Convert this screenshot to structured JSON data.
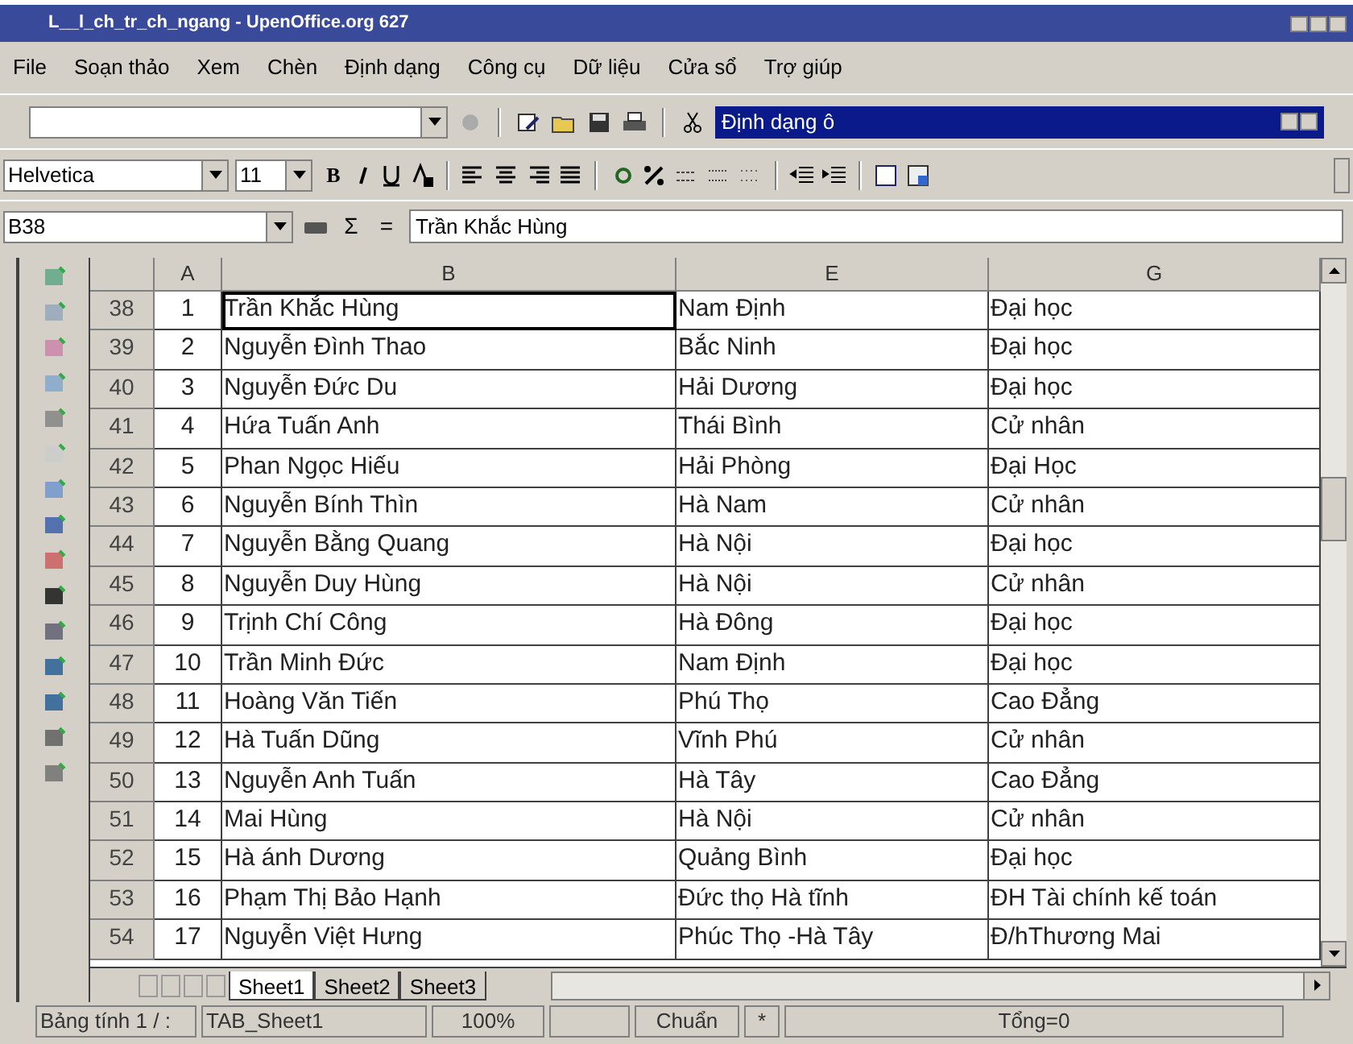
{
  "window": {
    "title": "L__l_ch_tr_ch_ngang - UpenOffice.org 627"
  },
  "menu": [
    "File",
    "Soạn thảo",
    "Xem",
    "Chèn",
    "Định dạng",
    "Công cụ",
    "Dữ liệu",
    "Cửa sổ",
    "Trợ giúp"
  ],
  "floating_toolbar": {
    "title": "Định dạng ô"
  },
  "format_bar": {
    "font": "Helvetica",
    "size": "11",
    "bold": "B"
  },
  "formula_bar": {
    "cell": "B38",
    "content": "Trần Khắc Hùng",
    "sum": "Σ",
    "equals": "="
  },
  "table": {
    "columns": [
      "A",
      "B",
      "E",
      "G"
    ],
    "rows": [
      {
        "row": "38",
        "cells": [
          "1",
          "Trần Khắc Hùng",
          "Nam Định",
          "Đại học"
        ],
        "selected": true
      },
      {
        "row": "39",
        "cells": [
          "2",
          "Nguyễn Đình Thao",
          "Bắc Ninh",
          "Đại học"
        ],
        "selected": false
      },
      {
        "row": "40",
        "cells": [
          "3",
          "Nguyễn Đức Du",
          "Hải Dương",
          "Đại học"
        ],
        "selected": false
      },
      {
        "row": "41",
        "cells": [
          "4",
          "Hứa Tuấn Anh",
          "Thái Bình",
          "Cử nhân"
        ],
        "selected": false
      },
      {
        "row": "42",
        "cells": [
          "5",
          "Phan Ngọc Hiếu",
          "Hải Phòng",
          "Đại Học"
        ],
        "selected": false
      },
      {
        "row": "43",
        "cells": [
          "6",
          "Nguyễn Bính Thìn",
          "Hà Nam",
          "Cử nhân"
        ],
        "selected": false
      },
      {
        "row": "44",
        "cells": [
          "7",
          "Nguyễn Bằng Quang",
          "Hà Nội",
          "Đại học"
        ],
        "selected": false
      },
      {
        "row": "45",
        "cells": [
          "8",
          "Nguyễn Duy Hùng",
          "Hà Nội",
          "Cử nhân"
        ],
        "selected": false
      },
      {
        "row": "46",
        "cells": [
          "9",
          "Trịnh Chí Công",
          "Hà Đông",
          "Đại học"
        ],
        "selected": false
      },
      {
        "row": "47",
        "cells": [
          "10",
          "Trần Minh Đức",
          "Nam Định",
          "Đại học"
        ],
        "selected": false
      },
      {
        "row": "48",
        "cells": [
          "11",
          "Hoàng Văn Tiến",
          "Phú Thọ",
          "Cao Đẳng"
        ],
        "selected": false
      },
      {
        "row": "49",
        "cells": [
          "12",
          "Hà Tuấn Dũng",
          "Vĩnh Phú",
          "Cử nhân"
        ],
        "selected": false
      },
      {
        "row": "50",
        "cells": [
          "13",
          "Nguyễn Anh Tuấn",
          "Hà Tây",
          "Cao Đẳng"
        ],
        "selected": false
      },
      {
        "row": "51",
        "cells": [
          "14",
          "Mai Hùng",
          "Hà Nội",
          "Cử nhân"
        ],
        "selected": false
      },
      {
        "row": "52",
        "cells": [
          "15",
          "Hà ánh Dương",
          "Quảng Bình",
          "Đại học"
        ],
        "selected": false
      },
      {
        "row": "53",
        "cells": [
          "16",
          "Phạm Thị Bảo Hạnh",
          "Đức thọ Hà tĩnh",
          "ĐH Tài chính kế toán"
        ],
        "selected": false
      },
      {
        "row": "54",
        "cells": [
          "17",
          "Nguyễn Việt Hưng",
          "Phúc Thọ -Hà Tây",
          "Đ/hThương Mai"
        ],
        "selected": false
      }
    ]
  },
  "sheet_tabs": [
    {
      "label": "Sheet1",
      "selected": true
    },
    {
      "label": "Sheet2",
      "selected": false
    },
    {
      "label": "Sheet3",
      "selected": false
    }
  ],
  "status_bar": [
    "Bảng tính  1 / :",
    "TAB_Sheet1",
    "100%",
    "Chuẩn",
    "*",
    "Tổng=0"
  ]
}
